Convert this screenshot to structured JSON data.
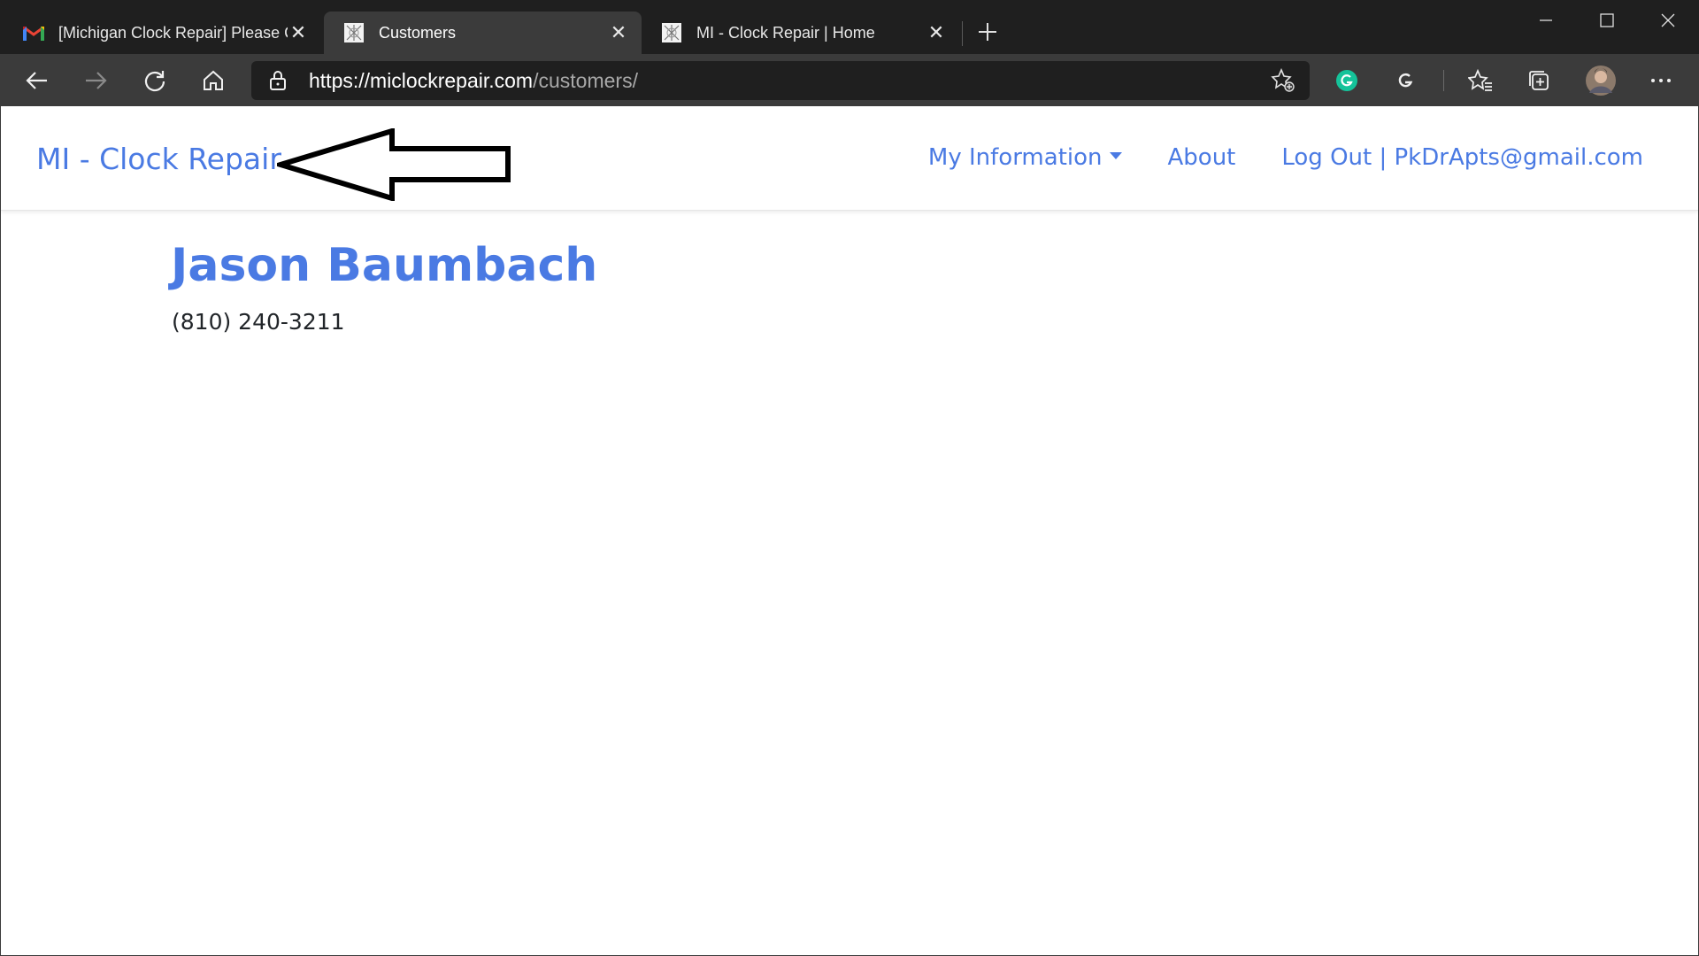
{
  "browser": {
    "tabs": [
      {
        "title": "[Michigan Clock Repair] Please C",
        "icon": "gmail-icon",
        "active": false
      },
      {
        "title": "Customers",
        "icon": "site-favicon",
        "active": true
      },
      {
        "title": "MI - Clock Repair | Home",
        "icon": "site-favicon",
        "active": false
      }
    ],
    "close_glyph": "✕",
    "address": {
      "host": "https://miclockrepair.com",
      "path": "/customers/"
    },
    "colors": {
      "titlebar": "#1f1f1f",
      "toolbar": "#3b3b3b",
      "grammarly_green": "#15c39a"
    }
  },
  "site": {
    "brand": "MI - Clock Repair",
    "nav": {
      "my_information": "My Information",
      "about": "About",
      "logout": "Log Out | PkDrApts@gmail.com"
    },
    "accent": "#4a7ae3"
  },
  "customer": {
    "name": "Jason Baumbach",
    "phone": "(810) 240-3211"
  }
}
